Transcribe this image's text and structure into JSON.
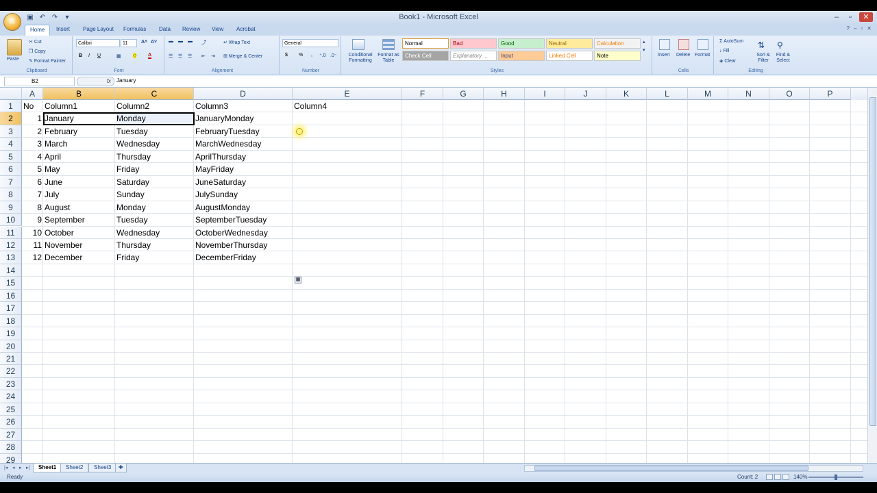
{
  "window": {
    "title": "Book1 - Microsoft Excel"
  },
  "ribbon": {
    "tabs": [
      "Home",
      "Insert",
      "Page Layout",
      "Formulas",
      "Data",
      "Review",
      "View",
      "Acrobat"
    ],
    "clipboard": {
      "paste": "Paste",
      "cut": "Cut",
      "copy": "Copy",
      "format_painter": "Format Painter",
      "label": "Clipboard"
    },
    "font": {
      "name": "Calibri",
      "size": "11",
      "label": "Font"
    },
    "alignment": {
      "wrap_text": "Wrap Text",
      "merge_center": "Merge & Center",
      "label": "Alignment"
    },
    "number": {
      "format": "General",
      "label": "Number"
    },
    "styles": {
      "conditional": "Conditional Formatting",
      "format_table": "Format as Table",
      "items": [
        {
          "label": "Normal",
          "bg": "#ffffff",
          "fg": "#000000"
        },
        {
          "label": "Bad",
          "bg": "#ffc7ce",
          "fg": "#9c0006"
        },
        {
          "label": "Good",
          "bg": "#c6efce",
          "fg": "#006100"
        },
        {
          "label": "Neutral",
          "bg": "#ffeb9c",
          "fg": "#9c6500"
        },
        {
          "label": "Calculation",
          "bg": "#f2f2f2",
          "fg": "#fa7d00"
        },
        {
          "label": "Check Cell",
          "bg": "#a5a5a5",
          "fg": "#ffffff"
        },
        {
          "label": "Explanatory ...",
          "bg": "#ffffff",
          "fg": "#7f7f7f"
        },
        {
          "label": "Input",
          "bg": "#ffcc99",
          "fg": "#3f3f76"
        },
        {
          "label": "Linked Cell",
          "bg": "#ffffff",
          "fg": "#fa7d00"
        },
        {
          "label": "Note",
          "bg": "#ffffcc",
          "fg": "#000000"
        }
      ],
      "label": "Styles"
    },
    "cells": {
      "insert": "Insert",
      "delete": "Delete",
      "format": "Format",
      "label": "Cells"
    },
    "editing": {
      "autosum": "AutoSum",
      "fill": "Fill",
      "clear": "Clear",
      "sort_filter": "Sort & Filter",
      "find_select": "Find & Select",
      "label": "Editing"
    }
  },
  "formula_bar": {
    "name_box": "B2",
    "fx": "fx",
    "value": "January"
  },
  "columns": [
    "A",
    "B",
    "C",
    "D",
    "E",
    "F",
    "G",
    "H",
    "I",
    "J",
    "K",
    "L",
    "M",
    "N",
    "O",
    "P"
  ],
  "selected_columns": [
    "B",
    "C"
  ],
  "selected_row": 2,
  "rows": [
    [
      "No",
      "Column1",
      "Column2",
      "Column3",
      "Column4"
    ],
    [
      "1",
      "January",
      "Monday",
      "JanuaryMonday",
      ""
    ],
    [
      "2",
      "February",
      "Tuesday",
      "FebruaryTuesday",
      ""
    ],
    [
      "3",
      "March",
      "Wednesday",
      "MarchWednesday",
      ""
    ],
    [
      "4",
      "April",
      "Thursday",
      "AprilThursday",
      ""
    ],
    [
      "5",
      "May",
      "Friday",
      "MayFriday",
      ""
    ],
    [
      "6",
      "June",
      "Saturday",
      "JuneSaturday",
      ""
    ],
    [
      "7",
      "July",
      "Sunday",
      "JulySunday",
      ""
    ],
    [
      "8",
      "August",
      "Monday",
      "AugustMonday",
      ""
    ],
    [
      "9",
      "September",
      "Tuesday",
      "SeptemberTuesday",
      ""
    ],
    [
      "10",
      "October",
      "Wednesday",
      "OctoberWednesday",
      ""
    ],
    [
      "11",
      "November",
      "Thursday",
      "NovemberThursday",
      ""
    ],
    [
      "12",
      "December",
      "Friday",
      "DecemberFriday",
      ""
    ]
  ],
  "row_count": 29,
  "sheets": [
    "Sheet1",
    "Sheet2",
    "Sheet3"
  ],
  "active_sheet": "Sheet1",
  "status": {
    "ready": "Ready",
    "count": "Count: 2",
    "zoom": "140%"
  }
}
